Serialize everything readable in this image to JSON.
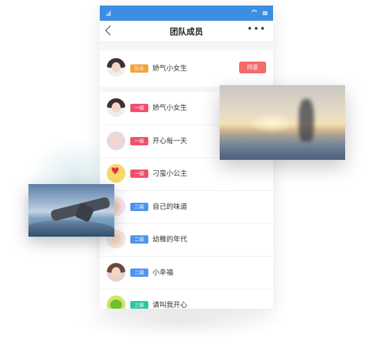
{
  "page": {
    "title": "团队成员",
    "more_icon": "more-icon",
    "back_icon": "back-chevron-icon"
  },
  "leader": {
    "role": "队长",
    "name": "娇气小女生",
    "action": "同意",
    "badge_color": "#f4a33a"
  },
  "members": [
    {
      "role": "一级",
      "name": "娇气小女生",
      "badge_color": "#f0506e"
    },
    {
      "role": "一级",
      "name": "开心每一天",
      "badge_color": "#f0506e"
    },
    {
      "role": "一级",
      "name": "刁蛮小公主",
      "badge_color": "#f0506e"
    },
    {
      "role": "二级",
      "name": "自己的味道",
      "badge_color": "#4f93f2"
    },
    {
      "role": "二级",
      "name": "幼稚的年代",
      "badge_color": "#4f93f2"
    },
    {
      "role": "二级",
      "name": "小幸福",
      "badge_color": "#4f93f2"
    },
    {
      "role": "三级",
      "name": "请叫我开心",
      "badge_color": "#2ac5a4"
    }
  ],
  "colors": {
    "statusbar": "#3c8ee2",
    "agree_button": "#f36b6b"
  }
}
